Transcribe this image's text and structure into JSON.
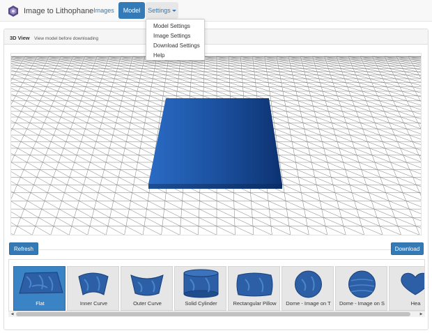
{
  "navbar": {
    "brand": "Image to Lithophane",
    "tabs": [
      {
        "label": "Images"
      },
      {
        "label": "Model"
      },
      {
        "label": "Settings"
      }
    ],
    "brand_color": "#337ab7"
  },
  "settings_menu": {
    "items": [
      "Model Settings",
      "Image Settings",
      "Download Settings",
      "Help"
    ]
  },
  "panel": {
    "title": "3D View",
    "subtitle": "View model before downloading"
  },
  "actions": {
    "refresh_label": "Refresh",
    "download_label": "Download"
  },
  "shapes": [
    {
      "label": "Flat",
      "icon": "flat-plate-icon",
      "selected": true
    },
    {
      "label": "Inner Curve",
      "icon": "inner-curve-icon",
      "selected": false
    },
    {
      "label": "Outer Curve",
      "icon": "outer-curve-icon",
      "selected": false
    },
    {
      "label": "Solid Cylinder",
      "icon": "solid-cylinder-icon",
      "selected": false
    },
    {
      "label": "Rectangular Pillow",
      "icon": "rectangular-pillow-icon",
      "selected": false
    },
    {
      "label": "Dome - Image on T",
      "icon": "dome-top-icon",
      "selected": false
    },
    {
      "label": "Dome - Image on S",
      "icon": "dome-side-icon",
      "selected": false
    },
    {
      "label": "Hea",
      "icon": "heart-icon",
      "selected": false
    }
  ],
  "colors": {
    "accent": "#337ab7",
    "model": "#1f5aa8"
  }
}
